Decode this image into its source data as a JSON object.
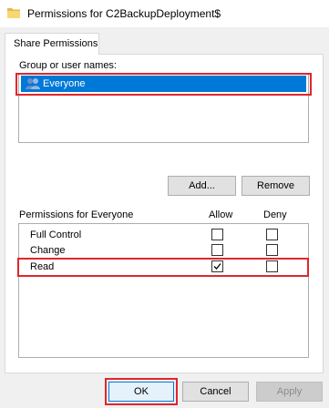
{
  "window": {
    "title": "Permissions for C2BackupDeployment$"
  },
  "tabs": [
    {
      "label": "Share Permissions"
    }
  ],
  "group": {
    "label": "Group or user names:",
    "items": [
      {
        "name": "Everyone",
        "selected": true
      }
    ]
  },
  "buttons": {
    "add": "Add...",
    "remove": "Remove",
    "ok": "OK",
    "cancel": "Cancel",
    "apply": "Apply"
  },
  "permissions": {
    "header": "Permissions for Everyone",
    "allow_header": "Allow",
    "deny_header": "Deny",
    "rows": [
      {
        "name": "Full Control",
        "allow": false,
        "deny": false
      },
      {
        "name": "Change",
        "allow": false,
        "deny": false
      },
      {
        "name": "Read",
        "allow": true,
        "deny": false
      }
    ]
  },
  "colors": {
    "selection": "#0078d7",
    "highlight": "#e0262b"
  }
}
